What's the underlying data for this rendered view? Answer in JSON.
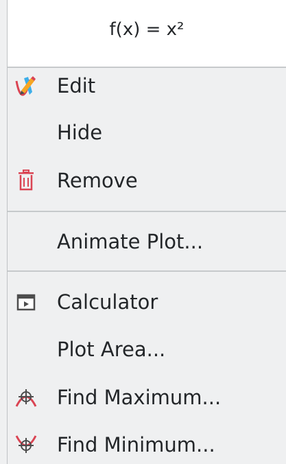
{
  "menu": {
    "title": "f(x) = x²",
    "items": [
      {
        "label": "Edit",
        "icon": "edit-plot-icon"
      },
      {
        "label": "Hide",
        "icon": ""
      },
      {
        "label": "Remove",
        "icon": "trash-icon"
      },
      {
        "label": "Animate Plot...",
        "icon": ""
      },
      {
        "label": "Calculator",
        "icon": "calculator-window-icon"
      },
      {
        "label": "Plot Area...",
        "icon": ""
      },
      {
        "label": "Find Maximum...",
        "icon": "find-maximum-icon"
      },
      {
        "label": "Find Minimum...",
        "icon": "find-minimum-icon"
      }
    ]
  },
  "colors": {
    "menu_background": "#eff0f1",
    "title_background": "#ffffff",
    "text": "#232629",
    "icon_red": "#da4453",
    "icon_blue": "#3daee9",
    "icon_gold": "#f6a623",
    "icon_dark": "#4d4d4d"
  }
}
